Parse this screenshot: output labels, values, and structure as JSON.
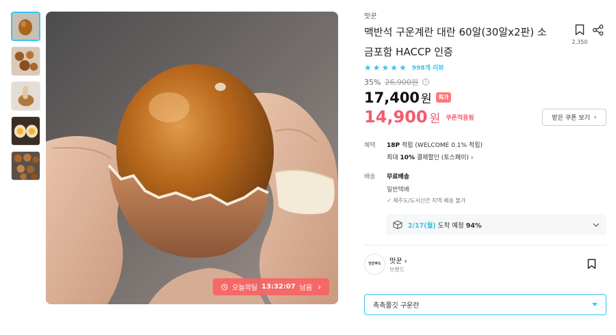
{
  "product": {
    "brand": "맛꾼",
    "title": "맥반석 구운계란 대란 60알(30알x2판) 소금포함 HACCP 인증",
    "bookmark_count": "2,350",
    "rating_stars": 5,
    "review_text": "998개 리뷰"
  },
  "pricing": {
    "discount_rate": "35%",
    "original_price": "26,900원",
    "sale_price": "17,400",
    "sale_currency": "원",
    "special_badge": "특가",
    "coupon_price": "14,900",
    "coupon_currency": "원",
    "coupon_applied_label": "쿠폰적용됨",
    "coupon_button_label": "받은 쿠폰 보기"
  },
  "deal": {
    "label": "오늘의딜",
    "time_left": "13:32:07",
    "suffix": "남음"
  },
  "benefits": {
    "label": "혜택",
    "points_amount": "18P",
    "points_rest": " 적립 (WELCOME 0.1% 적립)",
    "discount_prefix": "최대 ",
    "discount_amount": "10%",
    "discount_rest": " 결제할인 (토스페이)"
  },
  "shipping": {
    "label": "배송",
    "fee": "무료배송",
    "type": "일반택배",
    "note": "제주도/도서산간 지역 배송 불가",
    "delivery_date": "2/17(월)",
    "delivery_mid": " 도착 예정 ",
    "delivery_prob": "94%"
  },
  "store": {
    "logo_text": "맛꾼푸드",
    "name": "맛꾼",
    "sub": "브랜드"
  },
  "option": {
    "selected": "촉촉쫄깃 구운란"
  },
  "colors": {
    "accent": "#35c5f0",
    "sale": "#f35c6e"
  }
}
